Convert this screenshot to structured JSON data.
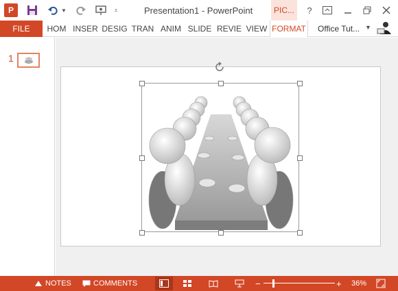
{
  "window": {
    "title": "Presentation1 - PowerPoint",
    "context_tab": "PIC...",
    "help": "?"
  },
  "app_logo": "P",
  "ribbon": {
    "file": "FILE",
    "tabs": [
      "HOM",
      "INSER",
      "DESIG",
      "TRAN",
      "ANIM",
      "SLIDE",
      "REVIE",
      "VIEW"
    ],
    "active_context_tab": "FORMAT",
    "user": "Office Tut..."
  },
  "thumbnails": [
    {
      "number": "1"
    }
  ],
  "status": {
    "notes": "NOTES",
    "comments": "COMMENTS",
    "zoom": "36%",
    "zoom_level": 0.36
  },
  "colors": {
    "accent": "#d24726",
    "status_bar": "#d24726",
    "context_tab_bg": "#fbe3dc"
  }
}
